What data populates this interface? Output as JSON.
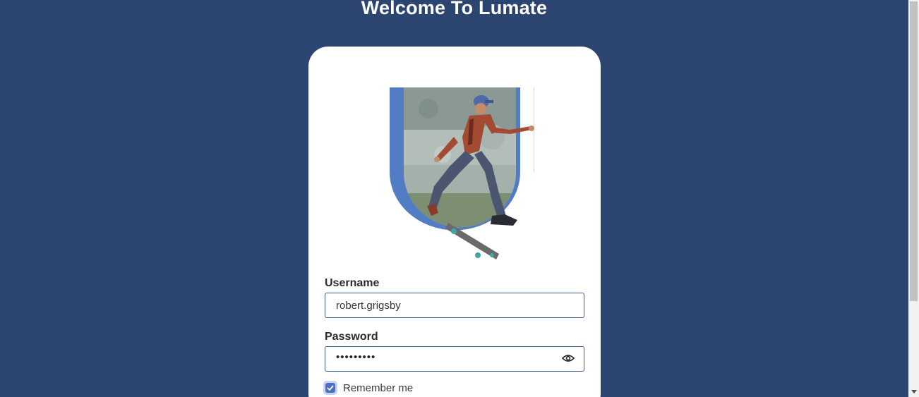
{
  "page": {
    "title": "Welcome To Lumate"
  },
  "login": {
    "username_label": "Username",
    "username_value": "robert.grigsby",
    "password_label": "Password",
    "password_mask": "•••••••••",
    "remember_label": "Remember me",
    "remember_checked": true
  },
  "icons": {
    "password_toggle": "eye-icon",
    "remember": "check-icon",
    "scroll_down": "chevron-down-icon"
  },
  "colors": {
    "background": "#2b4470",
    "accent": "#4a72c4",
    "brand_u": "#527cc4"
  }
}
